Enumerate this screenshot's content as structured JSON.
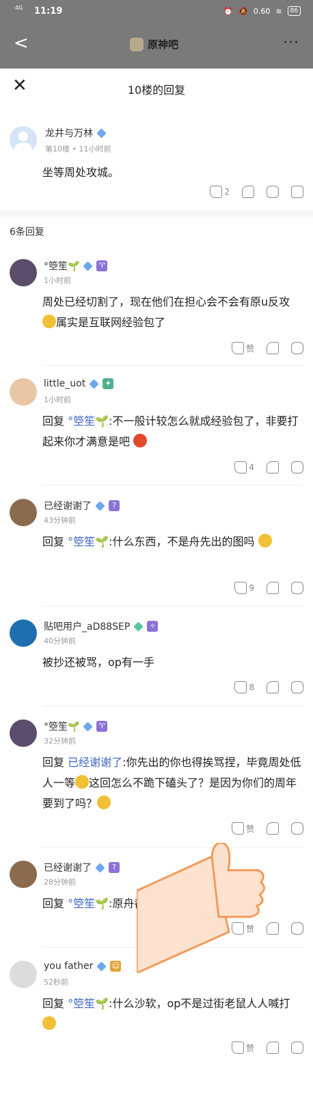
{
  "status": {
    "network": "4G",
    "time": "11:19",
    "speed": "0.60",
    "battery": "86"
  },
  "nav": {
    "back": "<",
    "forum": "原神吧",
    "more": "···"
  },
  "sheet": {
    "title": "10楼的回复",
    "close": "✕"
  },
  "main_post": {
    "user": "龙井与万林",
    "floor": "第10楼",
    "time": "11小时前",
    "content": "坐等周处攻城。",
    "likes": "2"
  },
  "reply_count": "6条回复",
  "replies": [
    {
      "user": "°箜笙🌱",
      "time": "1小时前",
      "content": "周处已经切割了，现在他们在担心会不会有原u反攻",
      "content2": "属实是互联网经验包了",
      "likes": "赞"
    },
    {
      "user": "little_uot",
      "time": "1小时前",
      "reply_to": "°箜笙🌱",
      "content": ":不一般计较怎么就成经验包了，非要打起来你才满意是吧",
      "likes": "4"
    },
    {
      "user": "已经谢谢了",
      "time": "43分钟前",
      "reply_to": "°箜笙🌱",
      "content": ":什么东西，不是舟先出的图吗",
      "likes": "9"
    },
    {
      "user": "贴吧用户_aD88SEP",
      "time": "40分钟前",
      "content": "被抄还被骂，op有一手",
      "likes": "8"
    },
    {
      "user": "°箜笙🌱",
      "time": "32分钟前",
      "reply_to": "已经谢谢了",
      "content": ":你先出的你也得挨骂捏，毕竟周处低人一等",
      "content2": "这回怎么不跪下磕头了？是因为你们的周年要到了吗？",
      "likes": "赞"
    },
    {
      "user": "已经谢谢了",
      "time": "28分钟前",
      "reply_to": "°箜笙🌱",
      "content": ":原舟都玩",
      "content_tail": "我自己",
      "likes": "赞"
    },
    {
      "user": "you father",
      "time": "52秒前",
      "reply_to": "°箜笙🌱",
      "content": ":什么沙软，op不是过街老鼠人人喊打",
      "likes": "赞"
    }
  ],
  "labels": {
    "reply_prefix": "回复"
  }
}
